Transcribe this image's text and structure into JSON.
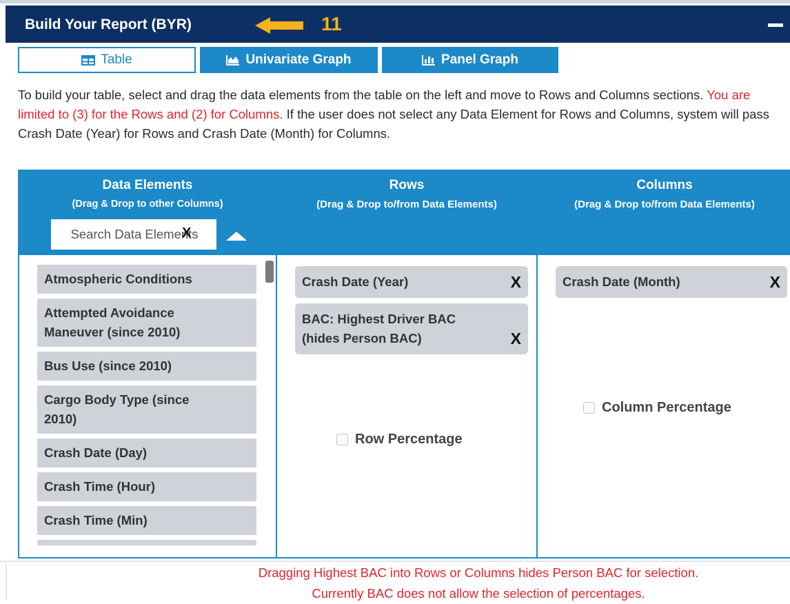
{
  "header": {
    "title": "Build Your Report (BYR)",
    "badge": "11",
    "colors": {
      "bar": "#0e2f63",
      "badge": "#f5b21a"
    }
  },
  "tabs": [
    {
      "label": "Table",
      "icon": "table-icon",
      "active": true
    },
    {
      "label": "Univariate Graph",
      "icon": "area-chart-icon",
      "active": false
    },
    {
      "label": "Panel Graph",
      "icon": "bar-chart-icon",
      "active": false
    }
  ],
  "instructions": {
    "part1": "To build your table, select and drag the data elements from the table on the left and move to Rows and Columns sections. ",
    "limit": "You are limited to (3) for the Rows and (2) for Columns.",
    "part2": " If the user does not select any Data Element for Rows and Columns, system will pass Crash Date (Year) for Rows and Crash Date (Month) for Columns."
  },
  "data_elements": {
    "heading": "Data Elements",
    "subheading": "(Drag & Drop to other Columns)",
    "search_placeholder": "Search Data Elements",
    "items": [
      "Atmospheric Conditions",
      "Attempted Avoidance Maneuver (since 2010)",
      "Bus Use (since 2010)",
      "Cargo Body Type (since 2010)",
      "Crash Date (Day)",
      "Crash Time (Hour)",
      "Crash Time (Min)"
    ]
  },
  "rows": {
    "heading": "Rows",
    "subheading": "(Drag & Drop to/from Data Elements)",
    "chips": [
      "Crash Date (Year)",
      "BAC: Highest Driver BAC (hides Person BAC)"
    ],
    "percentage_label": "Row Percentage",
    "percentage_checked": false
  },
  "columns": {
    "heading": "Columns",
    "subheading": "(Drag & Drop to/from Data Elements)",
    "chips": [
      "Crash Date (Month)"
    ],
    "percentage_label": "Column Percentage",
    "percentage_checked": false
  },
  "remove_label": "X",
  "notes": {
    "line1": "Dragging Highest BAC into Rows or Columns hides Person BAC for selection.",
    "line2": "Currently BAC does not allow the selection of percentages."
  },
  "colors": {
    "accent": "#1c89c8",
    "warning": "#e0262b",
    "chip": "#cfd2d8"
  }
}
